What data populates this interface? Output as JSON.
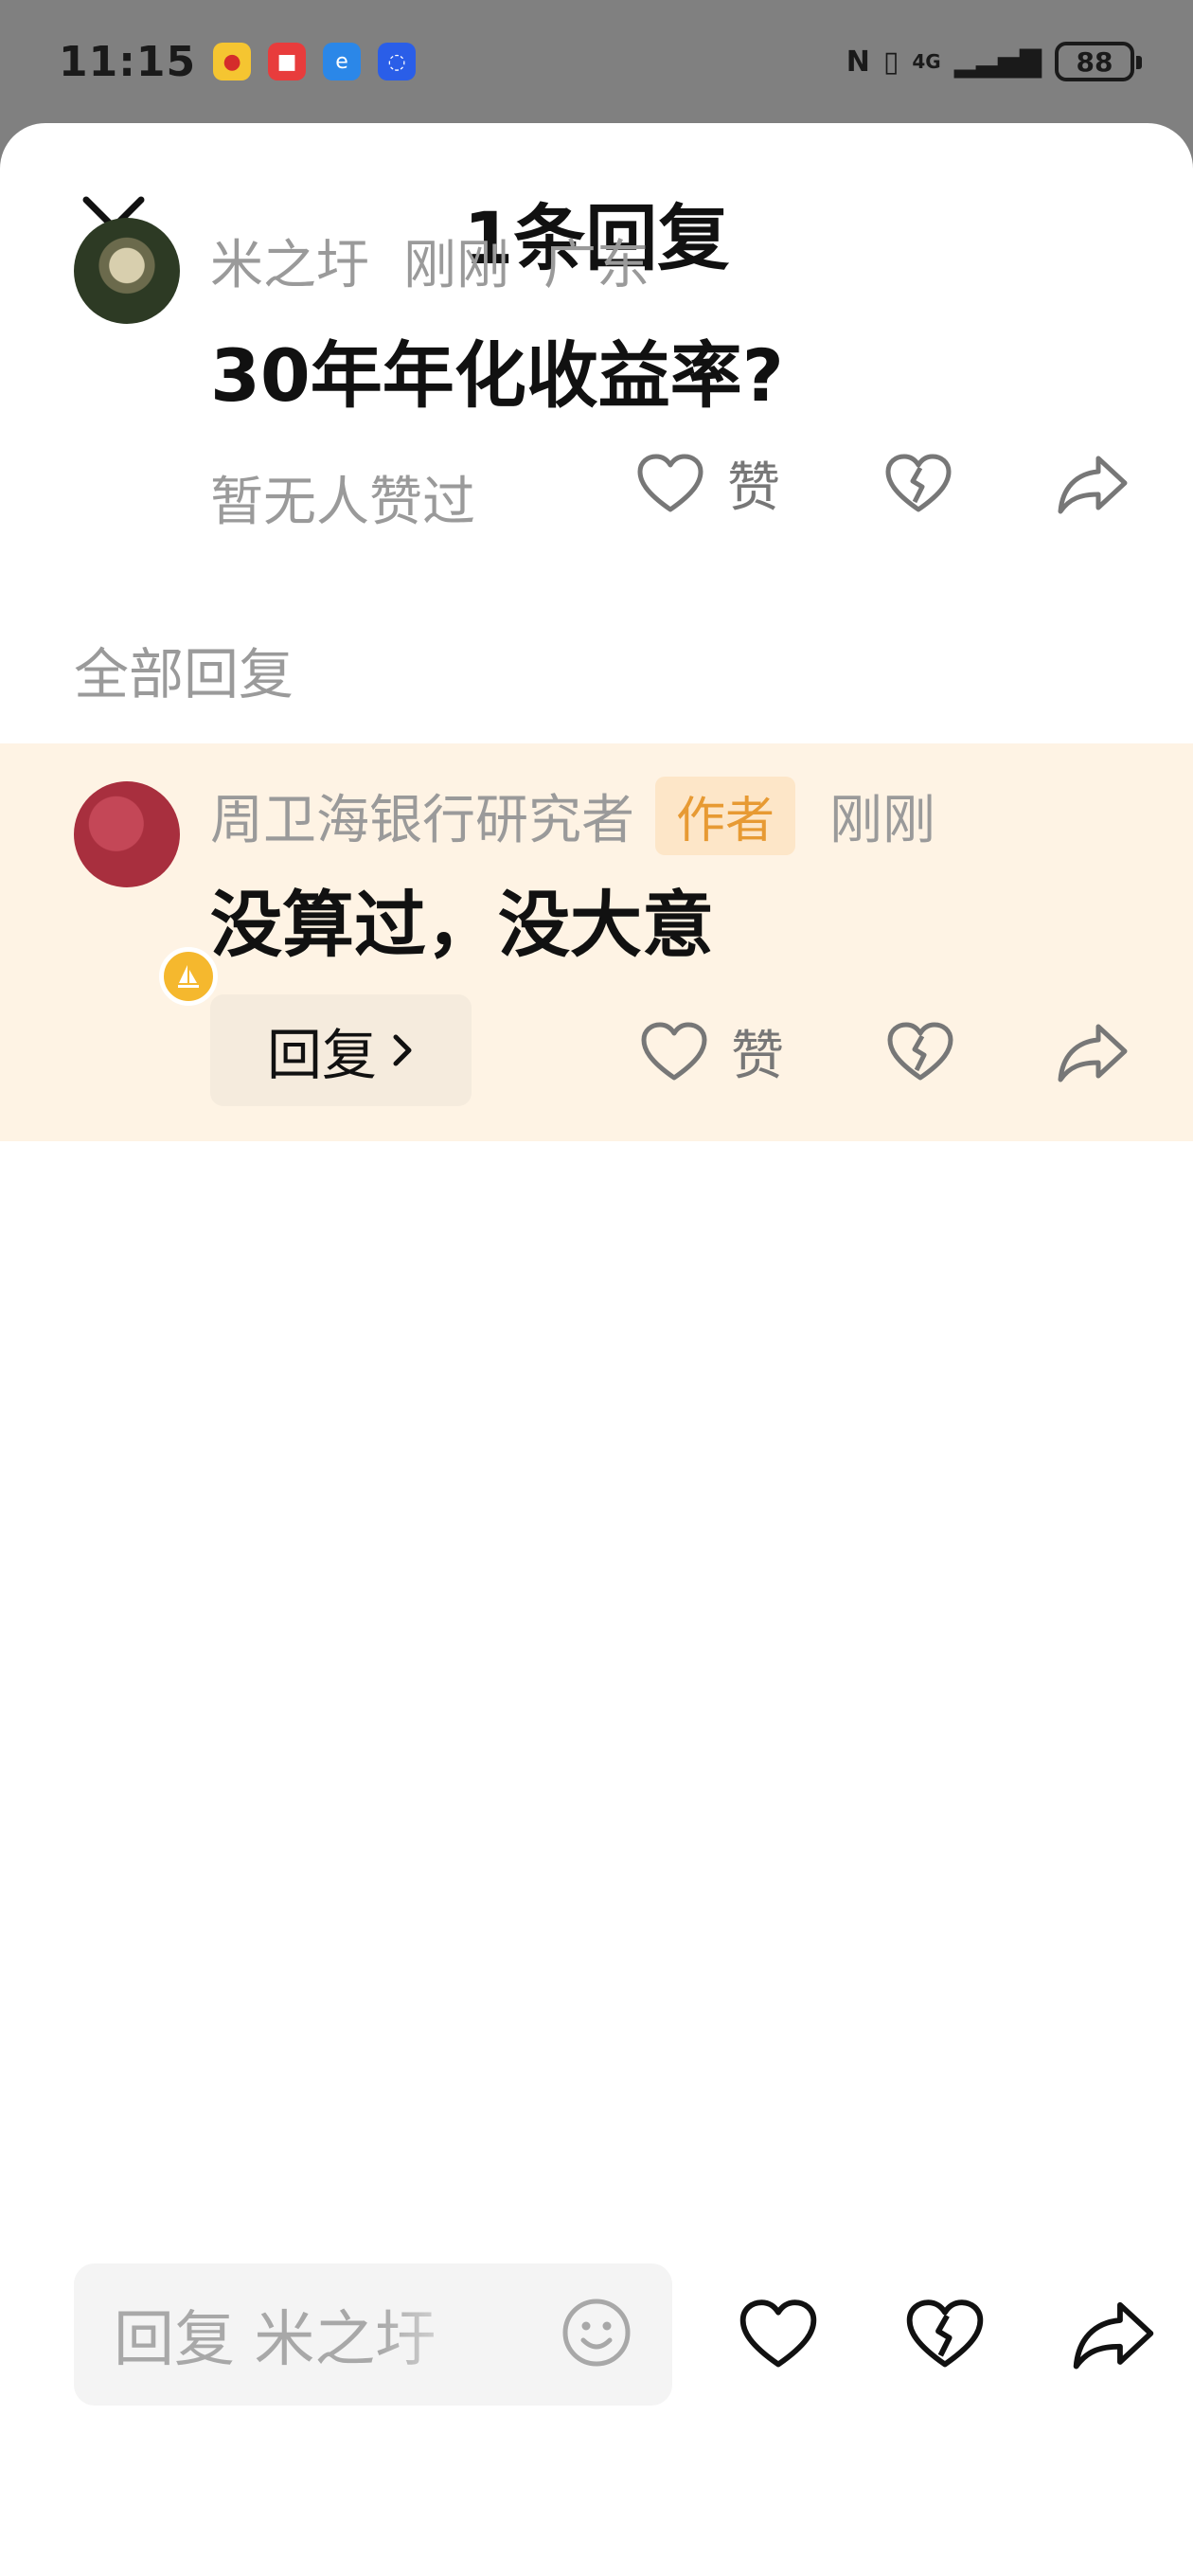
{
  "status_bar": {
    "time": "11:15",
    "network": "4G",
    "battery": "88",
    "notification_icons": [
      "weibo-icon",
      "shop-icon",
      "browser-icon",
      "bulb-icon"
    ]
  },
  "sheet": {
    "title": "1条回复",
    "close_icon": "close-icon"
  },
  "original_comment": {
    "username": "米之圩",
    "time": "刚刚",
    "location": "广东",
    "text": "30年年化收益率?",
    "likes_text": "暂无人赞过",
    "like_label": "赞"
  },
  "replies_section": {
    "label": "全部回复"
  },
  "reply": {
    "username": "周卫海银行研究者",
    "author_tag": "作者",
    "time": "刚刚",
    "text": "没算过，没大意",
    "reply_button_label": "回复",
    "like_label": "赞"
  },
  "bottom_bar": {
    "input_placeholder": "回复 米之圩"
  },
  "colors": {
    "highlight_bg": "#fef3e4",
    "author_tag_text": "#e79a33",
    "muted_text": "#9a9a9a"
  }
}
